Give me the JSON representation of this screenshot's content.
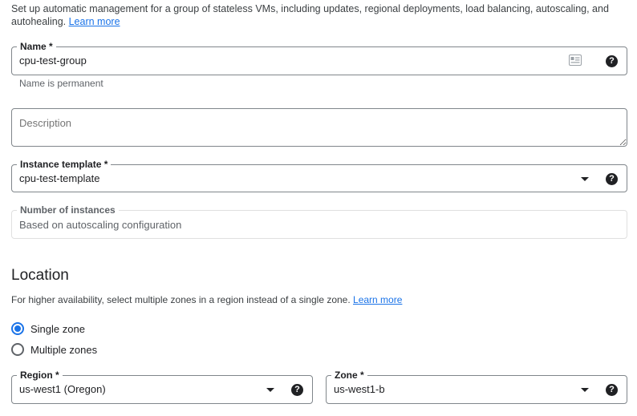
{
  "intro": {
    "text": "Set up automatic management for a group of stateless VMs, including updates, regional deployments, load balancing, autoscaling, and autohealing.",
    "link": "Learn more"
  },
  "name_field": {
    "label": "Name *",
    "value": "cpu-test-group",
    "hint": "Name is permanent",
    "icons": [
      "contact-card-icon",
      "help-icon"
    ]
  },
  "description_field": {
    "placeholder": "Description"
  },
  "template_field": {
    "label": "Instance template *",
    "value": "cpu-test-template",
    "icons": [
      "dropdown-arrow-icon",
      "help-icon"
    ]
  },
  "instances_field": {
    "label": "Number of instances",
    "value": "Based on autoscaling configuration"
  },
  "location": {
    "heading": "Location",
    "text": "For higher availability, select multiple zones in a region instead of a single zone.",
    "link": "Learn more",
    "options": [
      {
        "label": "Single zone",
        "selected": true
      },
      {
        "label": "Multiple zones",
        "selected": false
      }
    ]
  },
  "region_field": {
    "label": "Region *",
    "value": "us-west1 (Oregon)"
  },
  "zone_field": {
    "label": "Zone *",
    "value": "us-west1-b"
  },
  "colors": {
    "accent": "#1a73e8",
    "border": "#80868b",
    "text": "#202124",
    "muted": "#5f6368"
  }
}
